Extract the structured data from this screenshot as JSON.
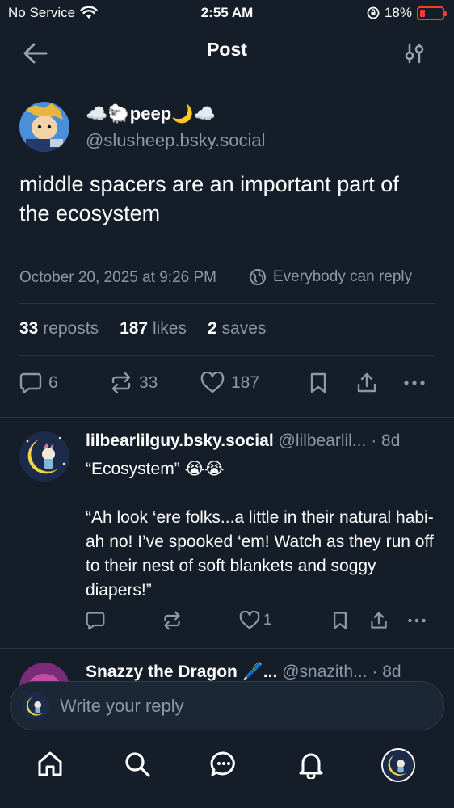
{
  "status_bar": {
    "carrier": "No Service",
    "time": "2:55 AM",
    "battery": "18%",
    "battery_level": 0.18
  },
  "header": {
    "title": "Post",
    "back_icon": "arrow-left-icon",
    "settings_icon": "sliders-icon"
  },
  "post": {
    "display_name": "☁️🐑peep🌙☁️",
    "handle": "@slusheep.bsky.social",
    "text": "middle spacers are an important part of the ecosystem",
    "timestamp": "October 20, 2025 at 9:26 PM",
    "reply_permission": "Everybody can reply",
    "stats": {
      "reposts_count": "33",
      "reposts_label": "reposts",
      "likes_count": "187",
      "likes_label": "likes",
      "saves_count": "2",
      "saves_label": "saves"
    },
    "actions": {
      "replies": "6",
      "reposts": "33",
      "likes": "187"
    }
  },
  "replies": [
    {
      "display_name": "lilbearlilguy.bsky.social",
      "handle": "@lilbearlil...",
      "age": "· 8d",
      "text_line1": "“Ecosystem” 😭😭",
      "text_body": "“Ah look ‘ere folks...a little in their natural habi- ah no! I’ve spooked ‘em! Watch as they run off to their nest of soft blankets and soggy diapers!”",
      "likes": "1"
    },
    {
      "display_name": "Snazzy the Dragon 🖊️...",
      "handle": "@snazith...",
      "age": "· 8d"
    }
  ],
  "compose": {
    "placeholder": "Write your reply"
  },
  "tabbar": {
    "items": [
      "home-icon",
      "search-icon",
      "chat-icon",
      "bell-icon",
      "profile-avatar"
    ]
  },
  "colors": {
    "background": "#151d28",
    "muted_text": "#8b98a9",
    "divider": "#2a3442",
    "battery_low": "#ff3b30"
  }
}
